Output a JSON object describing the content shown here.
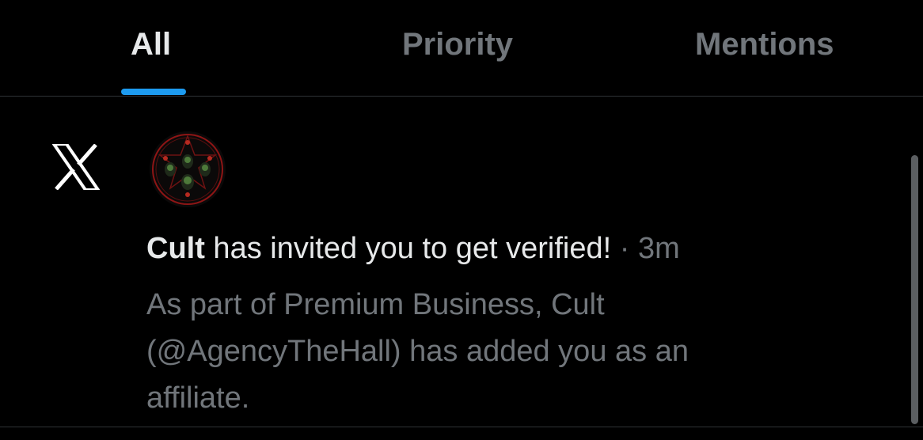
{
  "tabs": {
    "all": "All",
    "priority": "Priority",
    "mentions": "Mentions",
    "active": "all"
  },
  "notification": {
    "source_icon": "x-logo-icon",
    "avatar_icon": "cult-avatar",
    "actor": "Cult",
    "message": " has invited you to get verified!",
    "separator": " · ",
    "time": "3m",
    "body_lines": [
      "As part of Premium Business, Cult",
      "(@AgencyTheHall) has added you as an",
      "affiliate."
    ]
  },
  "colors": {
    "background": "#000000",
    "primary_text": "#e7e9ea",
    "secondary_text": "#71767b",
    "accent": "#1d9bf0",
    "divider": "#2f3336"
  }
}
